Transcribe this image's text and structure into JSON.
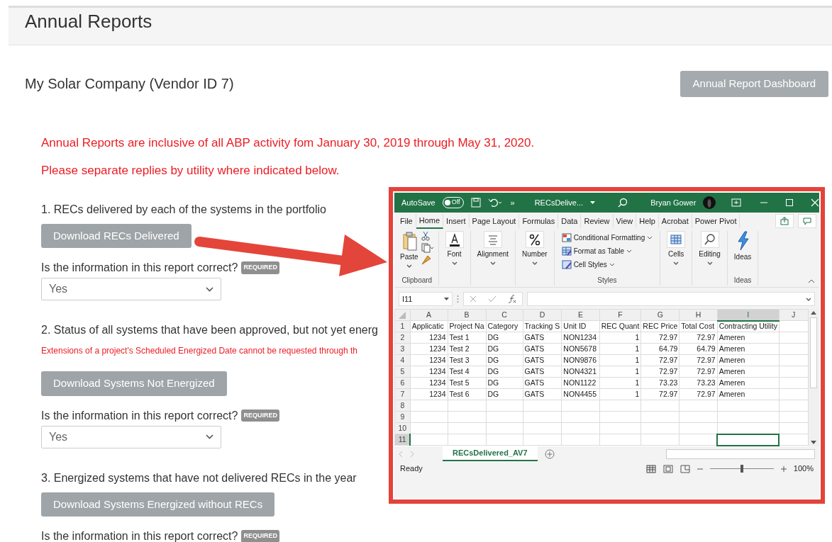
{
  "page": {
    "title": "Annual Reports"
  },
  "vendor": {
    "name": "My Solar Company (Vendor ID 7)",
    "dashboard_button": "Annual Report Dashboard"
  },
  "notices": [
    "Annual Reports are inclusive of all ABP activity fom January 30, 2019 through May 31, 2020.",
    "Please separate replies by utility where indicated below."
  ],
  "sections": [
    {
      "heading": "1. RECs delivered by each of the systems in the portfolio",
      "button": "Download RECs Delivered",
      "question": "Is the information in this report correct?",
      "badge": "REQUIRED",
      "answer": "Yes"
    },
    {
      "heading": "2. Status of all systems that have been approved, but not yet energ",
      "note": "Extensions of a project's Scheduled Energized Date cannot be requested through th",
      "button": "Download Systems Not Energized",
      "question": "Is the information in this report correct?",
      "badge": "REQUIRED",
      "answer": "Yes"
    },
    {
      "heading": "3. Energized systems that have not delivered RECs in the year",
      "button": "Download Systems Energized without RECs",
      "question": "Is the information in this report correct?",
      "badge": "REQUIRED"
    }
  ],
  "excel": {
    "title_bar": {
      "autosave": "AutoSave",
      "autosave_state": "Off",
      "autosave_on": false,
      "more": "»",
      "file_name": "RECsDelive...",
      "user": "Bryan Gower"
    },
    "menu_tabs": [
      {
        "label": "File",
        "selected": false
      },
      {
        "label": "Home",
        "selected": true
      },
      {
        "label": "Insert",
        "selected": false
      },
      {
        "label": "Page Layout",
        "selected": false
      },
      {
        "label": "Formulas",
        "selected": false
      },
      {
        "label": "Data",
        "selected": false
      },
      {
        "label": "Review",
        "selected": false
      },
      {
        "label": "View",
        "selected": false
      },
      {
        "label": "Help",
        "selected": false
      },
      {
        "label": "Acrobat",
        "selected": false
      },
      {
        "label": "Power Pivot",
        "selected": false
      }
    ],
    "ribbon_groups": [
      {
        "kind": "clipboard",
        "label": "Clipboard",
        "button": "Paste"
      },
      {
        "kind": "font",
        "button": "Font"
      },
      {
        "kind": "alignment",
        "button": "Alignment"
      },
      {
        "kind": "number",
        "button": "Number"
      },
      {
        "kind": "styles",
        "label": "Styles",
        "items": [
          "Conditional Formatting",
          "Format as Table",
          "Cell Styles"
        ]
      },
      {
        "kind": "cells",
        "button": "Cells"
      },
      {
        "kind": "editing",
        "button": "Editing"
      },
      {
        "kind": "ideas",
        "label": "Ideas",
        "button": "Ideas"
      }
    ],
    "name_box": "I11",
    "columns": [
      {
        "label": "A",
        "selected": false
      },
      {
        "label": "B",
        "selected": false
      },
      {
        "label": "C",
        "selected": false
      },
      {
        "label": "D",
        "selected": false
      },
      {
        "label": "E",
        "selected": false
      },
      {
        "label": "F",
        "selected": false
      },
      {
        "label": "G",
        "selected": false
      },
      {
        "label": "H",
        "selected": false
      },
      {
        "label": "I",
        "selected": true
      },
      {
        "label": "J",
        "selected": false
      }
    ],
    "rows": [
      {
        "number": "1",
        "kind": "header",
        "selected": false,
        "cells": [
          "Applicatic",
          "Project Na",
          "Category",
          "Tracking S",
          "Unit ID",
          "REC Quant",
          "REC Price",
          "Total Cost",
          "Contracting Utility"
        ]
      },
      {
        "number": "2",
        "kind": "data",
        "selected": false,
        "cells": [
          "1234",
          "Test 1",
          "DG",
          "GATS",
          "NON1234",
          "1",
          "72.97",
          "72.97",
          "Ameren"
        ]
      },
      {
        "number": "3",
        "kind": "data",
        "selected": false,
        "cells": [
          "1234",
          "Test 2",
          "DG",
          "GATS",
          "NON5678",
          "1",
          "64.79",
          "64.79",
          "Ameren"
        ]
      },
      {
        "number": "4",
        "kind": "data",
        "selected": false,
        "cells": [
          "1234",
          "Test 3",
          "DG",
          "GATS",
          "NON9876",
          "1",
          "72.97",
          "72.97",
          "Ameren"
        ]
      },
      {
        "number": "5",
        "kind": "data",
        "selected": false,
        "cells": [
          "1234",
          "Test 4",
          "DG",
          "GATS",
          "NON4321",
          "1",
          "72.97",
          "72.97",
          "Ameren"
        ]
      },
      {
        "number": "6",
        "kind": "data",
        "selected": false,
        "cells": [
          "1234",
          "Test 5",
          "DG",
          "GATS",
          "NON1122",
          "1",
          "73.23",
          "73.23",
          "Ameren"
        ]
      },
      {
        "number": "7",
        "kind": "data",
        "selected": false,
        "cells": [
          "1234",
          "Test 6",
          "DG",
          "GATS",
          "NON4455",
          "1",
          "72.97",
          "72.97",
          "Ameren"
        ]
      },
      {
        "number": "8",
        "kind": "empty",
        "selected": false
      },
      {
        "number": "9",
        "kind": "empty",
        "selected": false
      },
      {
        "number": "10",
        "kind": "empty",
        "selected": false
      },
      {
        "number": "11",
        "kind": "empty",
        "selected": true
      }
    ],
    "sheet_tab": {
      "label": "RECsDelivered_AV7",
      "selected": true
    },
    "status": "Ready",
    "zoom": {
      "reading": "100%",
      "level": 0.5
    }
  }
}
